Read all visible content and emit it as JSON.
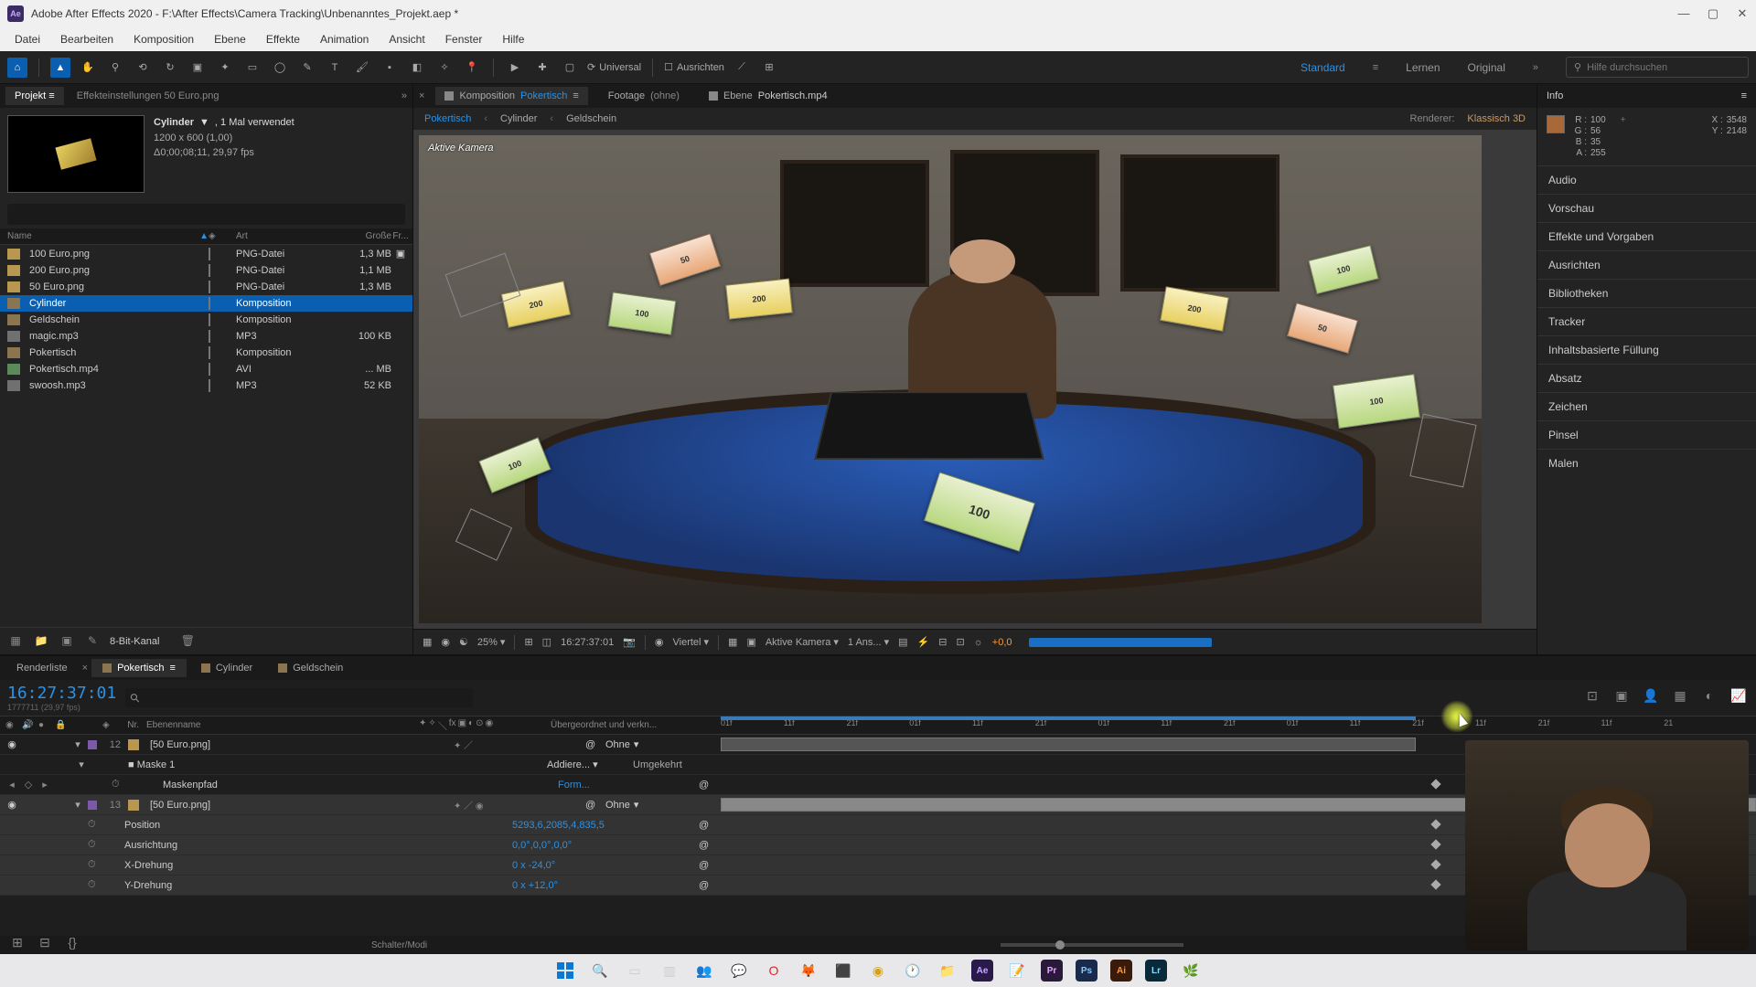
{
  "titlebar": {
    "app": "Adobe After Effects 2020",
    "path": "F:\\After Effects\\Camera Tracking\\Unbenanntes_Projekt.aep *"
  },
  "menubar": [
    "Datei",
    "Bearbeiten",
    "Komposition",
    "Ebene",
    "Effekte",
    "Animation",
    "Ansicht",
    "Fenster",
    "Hilfe"
  ],
  "toolbar": {
    "universal": "Universal",
    "ausrichten": "Ausrichten",
    "workspace_active": "Standard",
    "workspace_others": [
      "Lernen",
      "Original"
    ],
    "search_placeholder": "Hilfe durchsuchen"
  },
  "project": {
    "tab_label": "Projekt",
    "settings_label": "Effekteinstellungen 50 Euro.png",
    "selected_asset": {
      "name": "Cylinder",
      "usage": ", 1 Mal verwendet",
      "dims": "1200 x 600 (1,00)",
      "dur": "Δ0;00;08;11, 29,97 fps"
    },
    "columns": {
      "name": "Name",
      "type": "Art",
      "size": "Große",
      "extra": "Fr..."
    },
    "items": [
      {
        "name": "100 Euro.png",
        "type": "PNG-Datei",
        "size": "1,3 MB",
        "icon": "png",
        "flag": true
      },
      {
        "name": "200 Euro.png",
        "type": "PNG-Datei",
        "size": "1,1 MB",
        "icon": "png"
      },
      {
        "name": "50 Euro.png",
        "type": "PNG-Datei",
        "size": "1,3 MB",
        "icon": "png"
      },
      {
        "name": "Cylinder",
        "type": "Komposition",
        "size": "",
        "icon": "comp",
        "selected": true
      },
      {
        "name": "Geldschein",
        "type": "Komposition",
        "size": "",
        "icon": "comp"
      },
      {
        "name": "magic.mp3",
        "type": "MP3",
        "size": "100 KB",
        "icon": "mp3"
      },
      {
        "name": "Pokertisch",
        "type": "Komposition",
        "size": "",
        "icon": "comp"
      },
      {
        "name": "Pokertisch.mp4",
        "type": "AVI",
        "size": "... MB",
        "icon": "avi"
      },
      {
        "name": "swoosh.mp3",
        "type": "MP3",
        "size": "52 KB",
        "icon": "mp3"
      }
    ],
    "footer_depth": "8-Bit-Kanal"
  },
  "comp": {
    "tabs": [
      {
        "prefix": "Komposition",
        "name": "Pokertisch",
        "active": true,
        "closable": true
      },
      {
        "prefix": "Footage",
        "name": "(ohne)"
      },
      {
        "prefix": "Ebene",
        "name": "Pokertisch.mp4"
      }
    ],
    "breadcrumb": [
      "Pokertisch",
      "Cylinder",
      "Geldschein"
    ],
    "renderer_label": "Renderer:",
    "renderer_value": "Klassisch 3D",
    "camera_label": "Aktive Kamera",
    "footer": {
      "zoom": "25%",
      "timecode": "16:27:37:01",
      "res": "Viertel",
      "camera": "Aktive Kamera",
      "views": "1 Ans...",
      "offset": "+0,0"
    }
  },
  "info": {
    "title": "Info",
    "r": "100",
    "g": "56",
    "b": "35",
    "a": "255",
    "x": "3548",
    "y": "2148",
    "swatch": "#a86838"
  },
  "side_panels": [
    "Audio",
    "Vorschau",
    "Effekte und Vorgaben",
    "Ausrichten",
    "Bibliotheken",
    "Tracker",
    "Inhaltsbasierte Füllung",
    "Absatz",
    "Zeichen",
    "Pinsel",
    "Malen"
  ],
  "timeline": {
    "tabs": [
      "Renderliste",
      "Pokertisch",
      "Cylinder",
      "Geldschein"
    ],
    "active_tab": 1,
    "timecode": "16:27:37:01",
    "timecode_sub": "1777711 (29,97 fps)",
    "header": {
      "nr": "Nr.",
      "ebenname": "Ebenenname",
      "override": "Übergeordnet und verkn..."
    },
    "ruler": [
      "01f",
      "11f",
      "21f",
      "01f",
      "11f",
      "21f",
      "01f",
      "11f",
      "21f",
      "01f",
      "11f",
      "21f",
      "11f",
      "21f",
      "11f",
      "21"
    ],
    "layers": [
      {
        "num": "12",
        "name": "[50 Euro.png]",
        "mode_label": "Ohne",
        "chip": "purple"
      },
      {
        "mask": "Maske 1",
        "mode": "Addiere...",
        "invert": "Umgekehrt"
      },
      {
        "prop": "Maskenpfad",
        "val": "Form..."
      },
      {
        "num": "13",
        "name": "[50 Euro.png]",
        "mode_label": "Ohne",
        "chip": "purple"
      },
      {
        "prop": "Position",
        "val": "5293,6,2085,4,835,5"
      },
      {
        "prop": "Ausrichtung",
        "val": "0,0°,0,0°,0,0°"
      },
      {
        "prop": "X-Drehung",
        "val": "0 x -24,0°"
      },
      {
        "prop": "Y-Drehung",
        "val": "0 x +12,0°"
      }
    ],
    "footer_label": "Schalter/Modi"
  },
  "taskbar": {
    "icons": [
      "windows",
      "search",
      "tasks",
      "desktops",
      "teams",
      "whatsapp",
      "opera",
      "firefox",
      "app1",
      "app2",
      "clock",
      "files",
      "ae",
      "editor",
      "pr",
      "ps",
      "ai",
      "lr",
      "misc"
    ]
  }
}
